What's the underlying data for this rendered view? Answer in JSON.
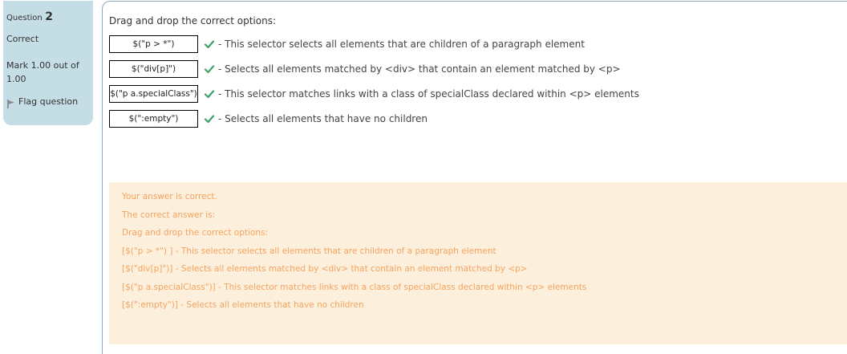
{
  "info": {
    "question_label": "Question",
    "question_number": "2",
    "state": "Correct",
    "grade": "Mark 1.00 out of 1.00",
    "flag_label": "Flag question"
  },
  "question": {
    "prompt": "Drag and drop the correct options:",
    "rows": [
      {
        "answer": "$(\"p > *\")",
        "description": "- This selector selects all elements that are children of a paragraph element"
      },
      {
        "answer": "$(\"div[p]\")",
        "description": "- Selects all elements matched by <div> that contain an element matched by <p>"
      },
      {
        "answer": "$(\"p a.specialClass\")",
        "description": "- This selector matches links with a class of specialClass declared within <p> elements"
      },
      {
        "answer": "$(\":empty\")",
        "description": "- Selects all elements that have no children"
      }
    ]
  },
  "feedback": {
    "lines": [
      "Your answer is correct.",
      "The correct answer is:",
      "Drag and drop the correct options:",
      "[$(\"p > *\") ] - This selector selects all elements that are children of a paragraph element",
      "[$(\"div[p]\")] - Selects all elements matched by <div> that contain an element matched by <p>",
      "[$(\"p a.specialClass\")] - This selector matches links with a class of specialClass declared within <p> elements",
      "[$(\":empty\")] - Selects all elements that have no children"
    ]
  },
  "colors": {
    "info_bg": "#c5dde5",
    "feedback_bg": "#fcefdc",
    "feedback_text": "#f5a35f",
    "check_green": "#3aa36a",
    "content_border": "#8ba9c1"
  }
}
